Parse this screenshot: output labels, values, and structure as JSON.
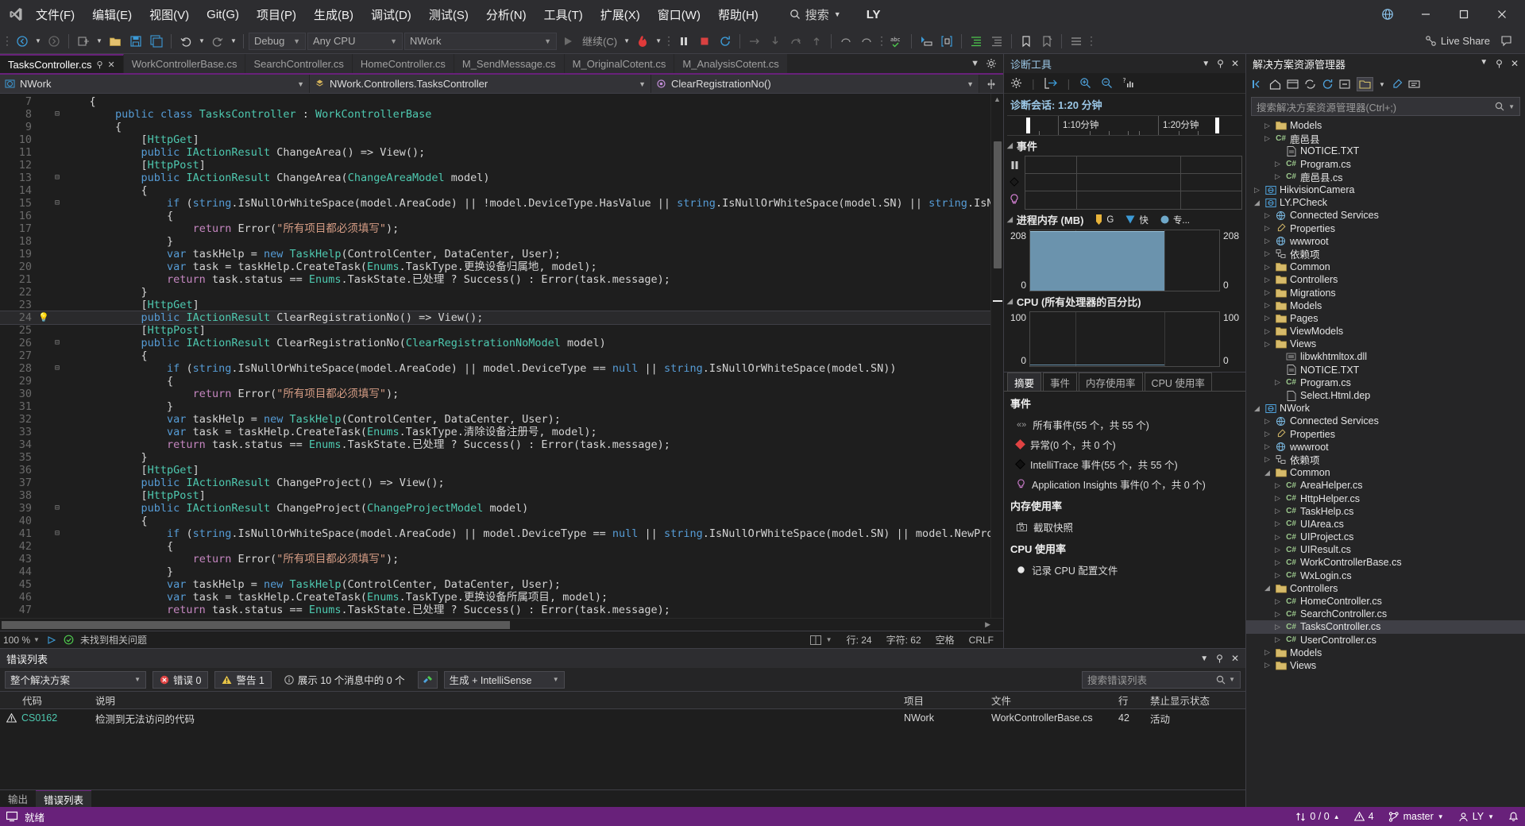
{
  "titlebar": {
    "logo_icon": "visual-studio-logo",
    "menus": [
      "文件(F)",
      "编辑(E)",
      "视图(V)",
      "Git(G)",
      "项目(P)",
      "生成(B)",
      "调试(D)",
      "测试(S)",
      "分析(N)",
      "工具(T)",
      "扩展(X)",
      "窗口(W)",
      "帮助(H)"
    ],
    "search_label": "搜索",
    "user_label": "LY",
    "globe_icon": "globe-icon",
    "minimize_icon": "minimize-icon",
    "maximize_icon": "maximize-icon",
    "close_icon": "close-icon"
  },
  "toolbar": {
    "config": "Debug",
    "platform": "Any CPU",
    "startup_project": "NWork",
    "continue_label": "继续(C)",
    "live_share": "Live Share"
  },
  "tabs": [
    {
      "label": "TasksController.cs",
      "active": true
    },
    {
      "label": "WorkControllerBase.cs",
      "active": false
    },
    {
      "label": "SearchController.cs",
      "active": false
    },
    {
      "label": "HomeController.cs",
      "active": false
    },
    {
      "label": "M_SendMessage.cs",
      "active": false
    },
    {
      "label": "M_OriginalCotent.cs",
      "active": false
    },
    {
      "label": "M_AnalysisCotent.cs",
      "active": false
    }
  ],
  "navbar": {
    "project": "NWork",
    "type": "NWork.Controllers.TasksController",
    "member": "ClearRegistrationNo()"
  },
  "editor": {
    "zoom": "100 %",
    "issue_status": "未找到相关问题",
    "line_label": "行: 24",
    "col_label": "字符: 62",
    "space_label": "空格",
    "eol_label": "CRLF",
    "lines": [
      {
        "n": "7",
        "fold": "",
        "glyph": "",
        "hl": false,
        "html": "    {"
      },
      {
        "n": "8",
        "fold": "-",
        "glyph": "",
        "hl": false,
        "html": "        <span class='k'>public</span> <span class='k'>class</span> <span class='kc'>TasksController</span> : <span class='kc'>WorkControllerBase</span>"
      },
      {
        "n": "9",
        "fold": "",
        "glyph": "",
        "hl": false,
        "html": "        {"
      },
      {
        "n": "10",
        "fold": "",
        "glyph": "",
        "hl": false,
        "html": "            [<span class='a'>HttpGet</span>]"
      },
      {
        "n": "11",
        "fold": "",
        "glyph": "",
        "hl": false,
        "html": "            <span class='k'>public</span> <span class='kc'>IActionResult</span> ChangeArea() =&gt; View();"
      },
      {
        "n": "12",
        "fold": "",
        "glyph": "",
        "hl": false,
        "html": "            [<span class='a'>HttpPost</span>]"
      },
      {
        "n": "13",
        "fold": "-",
        "glyph": "",
        "hl": false,
        "html": "            <span class='k'>public</span> <span class='kc'>IActionResult</span> ChangeArea(<span class='kc'>ChangeAreaModel</span> model)"
      },
      {
        "n": "14",
        "fold": "",
        "glyph": "",
        "hl": false,
        "html": "            {"
      },
      {
        "n": "15",
        "fold": "-",
        "glyph": "",
        "hl": false,
        "html": "                <span class='k'>if</span> (<span class='k'>string</span>.IsNullOrWhiteSpace(model.AreaCode) || !model.DeviceType.HasValue || <span class='k'>string</span>.IsNullOrWhiteSpace(model.SN) || <span class='k'>string</span>.IsN"
      },
      {
        "n": "16",
        "fold": "",
        "glyph": "",
        "hl": false,
        "html": "                {"
      },
      {
        "n": "17",
        "fold": "",
        "glyph": "",
        "hl": false,
        "html": "                    <span class='ctrl'>return</span> Error(<span class='s'>\"所有项目都必须填写\"</span>);"
      },
      {
        "n": "18",
        "fold": "",
        "glyph": "",
        "hl": false,
        "html": "                }"
      },
      {
        "n": "19",
        "fold": "",
        "glyph": "",
        "hl": false,
        "html": "                <span class='k'>var</span> taskHelp = <span class='k'>new</span> <span class='kc'>TaskHelp</span>(ControlCenter, DataCenter, User);"
      },
      {
        "n": "20",
        "fold": "",
        "glyph": "",
        "hl": false,
        "html": "                <span class='k'>var</span> task = taskHelp.CreateTask(<span class='kc'>Enums</span>.TaskType.更换设备归属地, model);"
      },
      {
        "n": "21",
        "fold": "",
        "glyph": "",
        "hl": false,
        "html": "                <span class='ctrl'>return</span> task.status == <span class='kc'>Enums</span>.TaskState.已处理 ? Success() : Error(task.message);"
      },
      {
        "n": "22",
        "fold": "",
        "glyph": "",
        "hl": false,
        "html": "            }"
      },
      {
        "n": "23",
        "fold": "",
        "glyph": "",
        "hl": false,
        "html": "            [<span class='a'>HttpGet</span>]"
      },
      {
        "n": "24",
        "fold": "",
        "glyph": "bulb",
        "hl": true,
        "html": "            <span class='k'>public</span> <span class='kc'>IActionResult</span> ClearRegistrationNo() =&gt; View();"
      },
      {
        "n": "25",
        "fold": "",
        "glyph": "",
        "hl": false,
        "html": "            [<span class='a'>HttpPost</span>]"
      },
      {
        "n": "26",
        "fold": "-",
        "glyph": "",
        "hl": false,
        "html": "            <span class='k'>public</span> <span class='kc'>IActionResult</span> ClearRegistrationNo(<span class='kc'>ClearRegistrationNoModel</span> model)"
      },
      {
        "n": "27",
        "fold": "",
        "glyph": "",
        "hl": false,
        "html": "            {"
      },
      {
        "n": "28",
        "fold": "-",
        "glyph": "",
        "hl": false,
        "html": "                <span class='k'>if</span> (<span class='k'>string</span>.IsNullOrWhiteSpace(model.AreaCode) || model.DeviceType == <span class='k'>null</span> || <span class='k'>string</span>.IsNullOrWhiteSpace(model.SN))"
      },
      {
        "n": "29",
        "fold": "",
        "glyph": "",
        "hl": false,
        "html": "                {"
      },
      {
        "n": "30",
        "fold": "",
        "glyph": "",
        "hl": false,
        "html": "                    <span class='ctrl'>return</span> Error(<span class='s'>\"所有项目都必须填写\"</span>);"
      },
      {
        "n": "31",
        "fold": "",
        "glyph": "",
        "hl": false,
        "html": "                }"
      },
      {
        "n": "32",
        "fold": "",
        "glyph": "",
        "hl": false,
        "html": "                <span class='k'>var</span> taskHelp = <span class='k'>new</span> <span class='kc'>TaskHelp</span>(ControlCenter, DataCenter, User);"
      },
      {
        "n": "33",
        "fold": "",
        "glyph": "",
        "hl": false,
        "html": "                <span class='k'>var</span> task = taskHelp.CreateTask(<span class='kc'>Enums</span>.TaskType.清除设备注册号, model);"
      },
      {
        "n": "34",
        "fold": "",
        "glyph": "",
        "hl": false,
        "html": "                <span class='ctrl'>return</span> task.status == <span class='kc'>Enums</span>.TaskState.已处理 ? Success() : Error(task.message);"
      },
      {
        "n": "35",
        "fold": "",
        "glyph": "",
        "hl": false,
        "html": "            }"
      },
      {
        "n": "36",
        "fold": "",
        "glyph": "",
        "hl": false,
        "html": "            [<span class='a'>HttpGet</span>]"
      },
      {
        "n": "37",
        "fold": "",
        "glyph": "",
        "hl": false,
        "html": "            <span class='k'>public</span> <span class='kc'>IActionResult</span> ChangeProject() =&gt; View();"
      },
      {
        "n": "38",
        "fold": "",
        "glyph": "",
        "hl": false,
        "html": "            [<span class='a'>HttpPost</span>]"
      },
      {
        "n": "39",
        "fold": "-",
        "glyph": "",
        "hl": false,
        "html": "            <span class='k'>public</span> <span class='kc'>IActionResult</span> ChangeProject(<span class='kc'>ChangeProjectModel</span> model)"
      },
      {
        "n": "40",
        "fold": "",
        "glyph": "",
        "hl": false,
        "html": "            {"
      },
      {
        "n": "41",
        "fold": "-",
        "glyph": "",
        "hl": false,
        "html": "                <span class='k'>if</span> (<span class='k'>string</span>.IsNullOrWhiteSpace(model.AreaCode) || model.DeviceType == <span class='k'>null</span> || <span class='k'>string</span>.IsNullOrWhiteSpace(model.SN) || model.NewPro"
      },
      {
        "n": "42",
        "fold": "",
        "glyph": "",
        "hl": false,
        "html": "                {"
      },
      {
        "n": "43",
        "fold": "",
        "glyph": "",
        "hl": false,
        "html": "                    <span class='ctrl'>return</span> Error(<span class='s'>\"所有项目都必须填写\"</span>);"
      },
      {
        "n": "44",
        "fold": "",
        "glyph": "",
        "hl": false,
        "html": "                }"
      },
      {
        "n": "45",
        "fold": "",
        "glyph": "",
        "hl": false,
        "html": "                <span class='k'>var</span> taskHelp = <span class='k'>new</span> <span class='kc'>TaskHelp</span>(ControlCenter, DataCenter, User);"
      },
      {
        "n": "46",
        "fold": "",
        "glyph": "",
        "hl": false,
        "html": "                <span class='k'>var</span> task = taskHelp.CreateTask(<span class='kc'>Enums</span>.TaskType.更换设备所属项目, model);"
      },
      {
        "n": "47",
        "fold": "",
        "glyph": "",
        "hl": false,
        "html": "                <span class='ctrl'>return</span> task.status == <span class='kc'>Enums</span>.TaskState.已处理 ? Success() : Error(task.message);"
      }
    ]
  },
  "errorlist": {
    "title": "错误列表",
    "scope": "整个解决方案",
    "errors_label": "错误 0",
    "warnings_label": "警告 1",
    "message_label": "展示 10 个消息中的 0 个",
    "build_filter": "生成 + IntelliSense",
    "search_placeholder": "搜索错误列表",
    "columns": [
      "代码",
      "说明",
      "项目",
      "文件",
      "行",
      "禁止显示状态"
    ],
    "rows": [
      {
        "severity": "warning",
        "code": "CS0162",
        "description": "检测到无法访问的代码",
        "project": "NWork",
        "file": "WorkControllerBase.cs",
        "line": "42",
        "suppression": "活动"
      }
    ],
    "bottom_tabs": [
      {
        "label": "输出",
        "active": false
      },
      {
        "label": "错误列表",
        "active": true
      }
    ]
  },
  "diagnostics": {
    "title": "诊断工具",
    "session_label": "诊断会话: 1:20 分钟",
    "timeline_labels": [
      "1:10分钟",
      "1:20分钟"
    ],
    "events_section": "事件",
    "memory_section": "进程内存 (MB)",
    "memory_legend": [
      "G",
      "快",
      "专..."
    ],
    "memory_max": "208",
    "memory_min": "0",
    "cpu_section": "CPU (所有处理器的百分比)",
    "cpu_max": "100",
    "cpu_min": "0",
    "tabs": [
      {
        "label": "摘要",
        "active": true
      },
      {
        "label": "事件",
        "active": false
      },
      {
        "label": "内存使用率",
        "active": false
      },
      {
        "label": "CPU 使用率",
        "active": false
      }
    ],
    "summary": {
      "events_title": "事件",
      "events_items": [
        {
          "icon": "chevrons-icon",
          "label": "所有事件(55 个，共 55 个)"
        },
        {
          "icon": "exception-diamond-icon",
          "label": "异常(0 个，共 0 个)"
        },
        {
          "icon": "intellitrace-diamond-icon",
          "label": "IntelliTrace 事件(55 个，共 55 个)"
        },
        {
          "icon": "lightbulb-icon",
          "label": "Application Insights 事件(0 个，共 0 个)"
        }
      ],
      "memory_title": "内存使用率",
      "memory_items": [
        {
          "icon": "camera-icon",
          "label": "截取快照"
        }
      ],
      "cpu_title": "CPU 使用率",
      "cpu_items": [
        {
          "icon": "record-icon",
          "label": "记录 CPU 配置文件"
        }
      ]
    }
  },
  "chart_data": [
    {
      "type": "area",
      "title": "进程内存 (MB)",
      "ylabel": "MB",
      "ylim": [
        0,
        208
      ],
      "x": [
        0,
        10,
        20,
        30,
        40,
        50,
        60,
        70,
        80
      ],
      "values": [
        208,
        208,
        208,
        208,
        208,
        208,
        208,
        0,
        0
      ],
      "legend": [
        "G",
        "快",
        "专..."
      ],
      "grid": true
    },
    {
      "type": "line",
      "title": "CPU (所有处理器的百分比)",
      "ylabel": "%",
      "ylim": [
        0,
        100
      ],
      "x": [
        0,
        10,
        20,
        30,
        40,
        50,
        60,
        70,
        80
      ],
      "values": [
        0,
        0,
        0,
        0,
        0,
        0,
        0,
        0,
        0
      ],
      "grid": true
    }
  ],
  "solution_explorer": {
    "title": "解决方案资源管理器",
    "search_placeholder": "搜索解决方案资源管理器(Ctrl+;)",
    "tree": [
      {
        "depth": 1,
        "exp": "▷",
        "icon": "folder",
        "label": "Models",
        "type": "folder"
      },
      {
        "depth": 1,
        "exp": "▷",
        "icon": "cs",
        "label": "鹿邑县",
        "type": "cs"
      },
      {
        "depth": 2,
        "exp": "",
        "icon": "txt",
        "label": "NOTICE.TXT",
        "type": "file"
      },
      {
        "depth": 2,
        "exp": "▷",
        "icon": "cs",
        "label": "Program.cs",
        "type": "cs"
      },
      {
        "depth": 2,
        "exp": "▷",
        "icon": "cs",
        "label": "鹿邑县.cs",
        "type": "cs"
      },
      {
        "depth": 0,
        "exp": "▷",
        "icon": "proj",
        "label": "HikvisionCamera",
        "type": "project"
      },
      {
        "depth": 0,
        "exp": "◢",
        "icon": "proj",
        "label": "LY.PCheck",
        "type": "project"
      },
      {
        "depth": 1,
        "exp": "▷",
        "icon": "services",
        "label": "Connected Services",
        "type": "node"
      },
      {
        "depth": 1,
        "exp": "▷",
        "icon": "props",
        "label": "Properties",
        "type": "node"
      },
      {
        "depth": 1,
        "exp": "▷",
        "icon": "globe",
        "label": "wwwroot",
        "type": "node"
      },
      {
        "depth": 1,
        "exp": "▷",
        "icon": "deps",
        "label": "依赖项",
        "type": "node"
      },
      {
        "depth": 1,
        "exp": "▷",
        "icon": "folder",
        "label": "Common",
        "type": "folder"
      },
      {
        "depth": 1,
        "exp": "▷",
        "icon": "folder",
        "label": "Controllers",
        "type": "folder"
      },
      {
        "depth": 1,
        "exp": "▷",
        "icon": "folder",
        "label": "Migrations",
        "type": "folder"
      },
      {
        "depth": 1,
        "exp": "▷",
        "icon": "folder",
        "label": "Models",
        "type": "folder"
      },
      {
        "depth": 1,
        "exp": "▷",
        "icon": "folder",
        "label": "Pages",
        "type": "folder"
      },
      {
        "depth": 1,
        "exp": "▷",
        "icon": "folder",
        "label": "ViewModels",
        "type": "folder"
      },
      {
        "depth": 1,
        "exp": "▷",
        "icon": "folder",
        "label": "Views",
        "type": "folder"
      },
      {
        "depth": 2,
        "exp": "",
        "icon": "dll",
        "label": "libwkhtmltox.dll",
        "type": "file"
      },
      {
        "depth": 2,
        "exp": "",
        "icon": "txt",
        "label": "NOTICE.TXT",
        "type": "file"
      },
      {
        "depth": 2,
        "exp": "▷",
        "icon": "cs",
        "label": "Program.cs",
        "type": "cs"
      },
      {
        "depth": 2,
        "exp": "",
        "icon": "dep",
        "label": "Select.Html.dep",
        "type": "file"
      },
      {
        "depth": 0,
        "exp": "◢",
        "icon": "proj",
        "label": "NWork",
        "type": "project"
      },
      {
        "depth": 1,
        "exp": "▷",
        "icon": "services",
        "label": "Connected Services",
        "type": "node"
      },
      {
        "depth": 1,
        "exp": "▷",
        "icon": "props",
        "label": "Properties",
        "type": "node"
      },
      {
        "depth": 1,
        "exp": "▷",
        "icon": "globe",
        "label": "wwwroot",
        "type": "node"
      },
      {
        "depth": 1,
        "exp": "▷",
        "icon": "deps",
        "label": "依赖项",
        "type": "node"
      },
      {
        "depth": 1,
        "exp": "◢",
        "icon": "folder",
        "label": "Common",
        "type": "folder"
      },
      {
        "depth": 2,
        "exp": "▷",
        "icon": "cs",
        "label": "AreaHelper.cs",
        "type": "cs"
      },
      {
        "depth": 2,
        "exp": "▷",
        "icon": "cs",
        "label": "HttpHelper.cs",
        "type": "cs"
      },
      {
        "depth": 2,
        "exp": "▷",
        "icon": "cs",
        "label": "TaskHelp.cs",
        "type": "cs"
      },
      {
        "depth": 2,
        "exp": "▷",
        "icon": "cs",
        "label": "UIArea.cs",
        "type": "cs"
      },
      {
        "depth": 2,
        "exp": "▷",
        "icon": "cs",
        "label": "UIProject.cs",
        "type": "cs"
      },
      {
        "depth": 2,
        "exp": "▷",
        "icon": "cs",
        "label": "UIResult.cs",
        "type": "cs"
      },
      {
        "depth": 2,
        "exp": "▷",
        "icon": "cs",
        "label": "WorkControllerBase.cs",
        "type": "cs"
      },
      {
        "depth": 2,
        "exp": "▷",
        "icon": "cs",
        "label": "WxLogin.cs",
        "type": "cs"
      },
      {
        "depth": 1,
        "exp": "◢",
        "icon": "folder",
        "label": "Controllers",
        "type": "folder"
      },
      {
        "depth": 2,
        "exp": "▷",
        "icon": "cs",
        "label": "HomeController.cs",
        "type": "cs"
      },
      {
        "depth": 2,
        "exp": "▷",
        "icon": "cs",
        "label": "SearchController.cs",
        "type": "cs"
      },
      {
        "depth": 2,
        "exp": "▷",
        "icon": "cs",
        "label": "TasksController.cs",
        "type": "cs",
        "selected": true
      },
      {
        "depth": 2,
        "exp": "▷",
        "icon": "cs",
        "label": "UserController.cs",
        "type": "cs"
      },
      {
        "depth": 1,
        "exp": "▷",
        "icon": "folder",
        "label": "Models",
        "type": "folder"
      },
      {
        "depth": 1,
        "exp": "▷",
        "icon": "folder",
        "label": "Views",
        "type": "folder"
      }
    ]
  },
  "statusbar": {
    "ready_label": "就绪",
    "changes_label": "0 / 0",
    "warnings_count": "4",
    "branch": "master",
    "user": "LY"
  },
  "colors": {
    "accent": "#68217a",
    "chart_fill": "#6b93ad",
    "error_red": "#e04343",
    "warn_yellow": "#e8c547",
    "link_teal": "#4ec9b0"
  }
}
